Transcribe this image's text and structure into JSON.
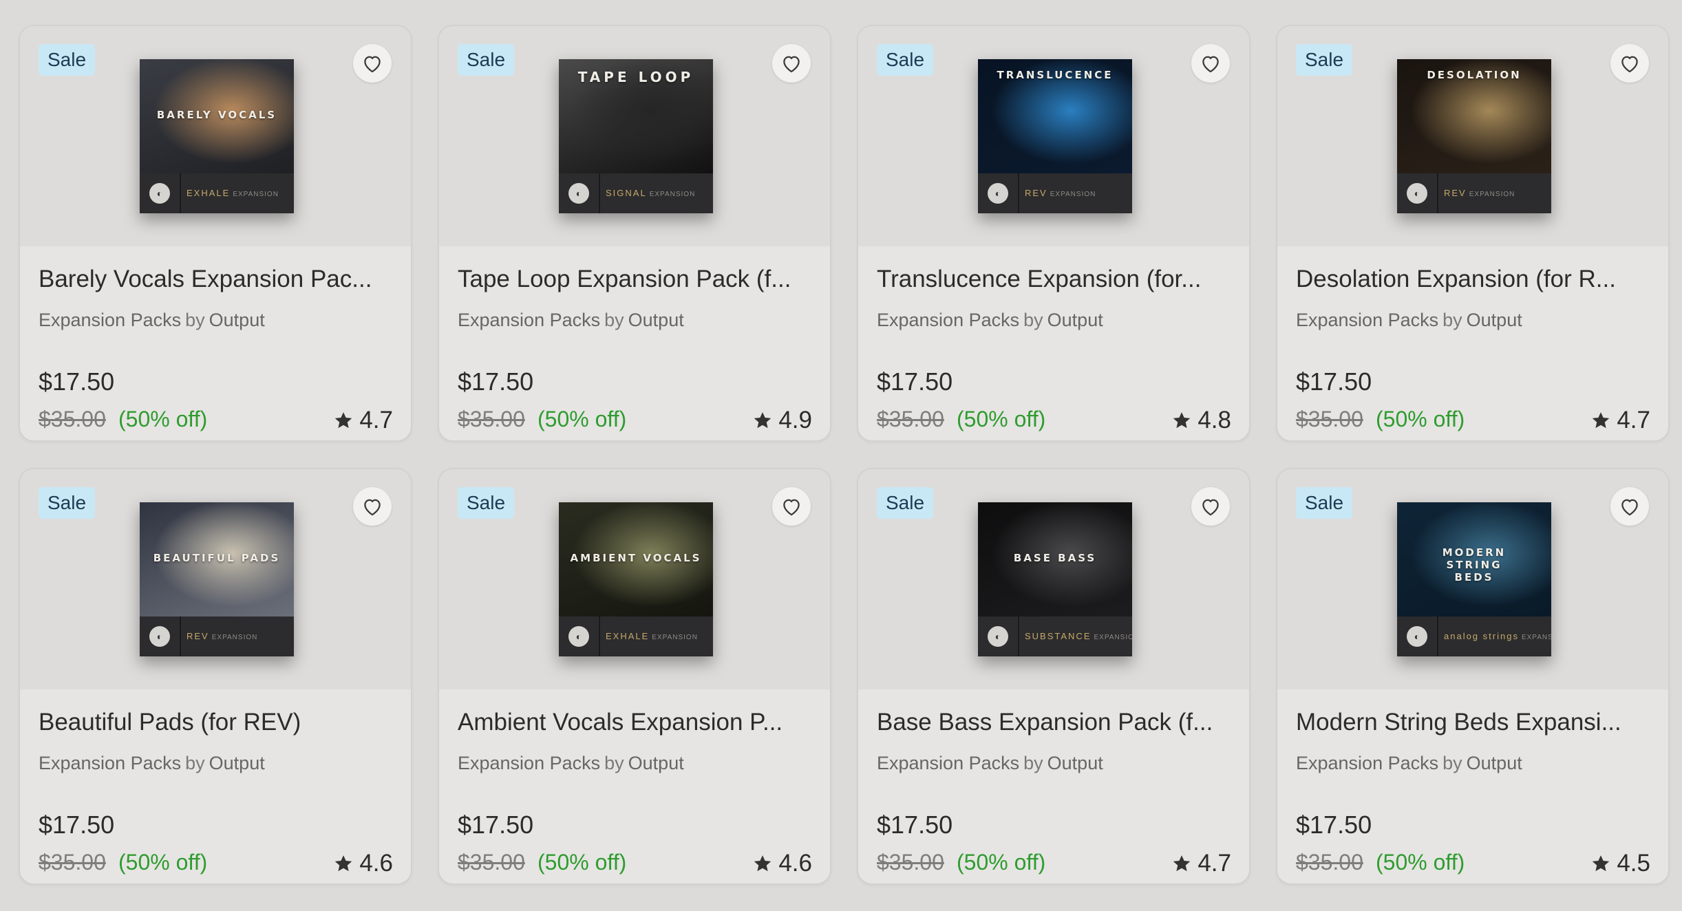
{
  "products": [
    {
      "badge": "Sale",
      "cover_title": "BARELY VOCALS",
      "cover_brand": "EXHALE",
      "cover_brand_suffix": "EXPANSION",
      "title": "Barely Vocals Expansion Pac...",
      "category": "Expansion Packs",
      "by": "by",
      "vendor": "Output",
      "price": "$17.50",
      "original_price": "$35.00",
      "discount": "(50% off)",
      "rating": "4.7",
      "colors": [
        "#3a3d44",
        "#b98a5c",
        "#1f2024"
      ]
    },
    {
      "badge": "Sale",
      "cover_title": "TAPE LOOP",
      "cover_brand": "SIGNAL",
      "cover_brand_suffix": "EXPANSION",
      "title": "Tape Loop Expansion Pack (f...",
      "category": "Expansion Packs",
      "by": "by",
      "vendor": "Output",
      "price": "$17.50",
      "original_price": "$35.00",
      "discount": "(50% off)",
      "rating": "4.9",
      "colors": [
        "#4a4a4a",
        "#262626",
        "#111111"
      ]
    },
    {
      "badge": "Sale",
      "cover_title": "TRANSLUCENCE",
      "cover_brand": "REV",
      "cover_brand_suffix": "EXPANSION",
      "title": "Translucence Expansion (for...",
      "category": "Expansion Packs",
      "by": "by",
      "vendor": "Output",
      "price": "$17.50",
      "original_price": "$35.00",
      "discount": "(50% off)",
      "rating": "4.8",
      "colors": [
        "#081424",
        "#2a7fc0",
        "#0b1a2e"
      ]
    },
    {
      "badge": "Sale",
      "cover_title": "DESOLATION",
      "cover_brand": "REV",
      "cover_brand_suffix": "EXPANSION",
      "title": "Desolation Expansion (for R...",
      "category": "Expansion Packs",
      "by": "by",
      "vendor": "Output",
      "price": "$17.50",
      "original_price": "$35.00",
      "discount": "(50% off)",
      "rating": "4.7",
      "colors": [
        "#1a1410",
        "#a48858",
        "#2a2118"
      ]
    },
    {
      "badge": "Sale",
      "cover_title": "BEAUTIFUL PADS",
      "cover_brand": "REV",
      "cover_brand_suffix": "EXPANSION",
      "title": "Beautiful Pads (for REV)",
      "category": "Expansion Packs",
      "by": "by",
      "vendor": "Output",
      "price": "$17.50",
      "original_price": "$35.00",
      "discount": "(50% off)",
      "rating": "4.6",
      "colors": [
        "#2f3440",
        "#c9c1b0",
        "#6b6f7a"
      ]
    },
    {
      "badge": "Sale",
      "cover_title": "AMBIENT VOCALS",
      "cover_brand": "EXHALE",
      "cover_brand_suffix": "EXPANSION",
      "title": "Ambient Vocals Expansion P...",
      "category": "Expansion Packs",
      "by": "by",
      "vendor": "Output",
      "price": "$17.50",
      "original_price": "$35.00",
      "discount": "(50% off)",
      "rating": "4.6",
      "colors": [
        "#2a2c20",
        "#7d7f58",
        "#15160f"
      ]
    },
    {
      "badge": "Sale",
      "cover_title": "BASE BASS",
      "cover_brand": "SUBSTANCE",
      "cover_brand_suffix": "EXPANSION",
      "title": "Base Bass Expansion Pack (f...",
      "category": "Expansion Packs",
      "by": "by",
      "vendor": "Output",
      "price": "$17.50",
      "original_price": "$35.00",
      "discount": "(50% off)",
      "rating": "4.7",
      "colors": [
        "#0e0e0f",
        "#4a4a4c",
        "#1c1c1e"
      ]
    },
    {
      "badge": "Sale",
      "cover_title": "MODERN STRING BEDS",
      "cover_brand": "analog strings",
      "cover_brand_suffix": "EXPANSION",
      "title": "Modern String Beds Expansi...",
      "category": "Expansion Packs",
      "by": "by",
      "vendor": "Output",
      "price": "$17.50",
      "original_price": "$35.00",
      "discount": "(50% off)",
      "rating": "4.5",
      "colors": [
        "#0e2436",
        "#3c6f8c",
        "#0a1a28"
      ]
    }
  ]
}
